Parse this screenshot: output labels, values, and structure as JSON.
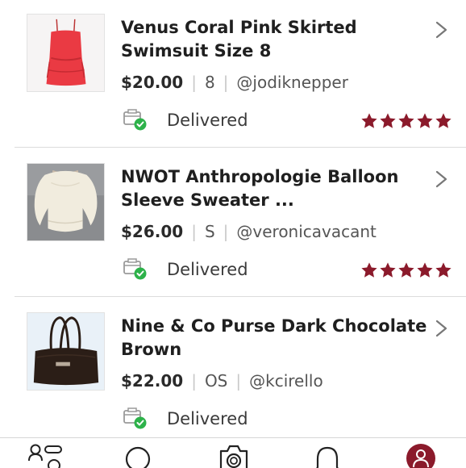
{
  "orders": [
    {
      "title": "Venus Coral Pink Skirted Swimsuit Size 8",
      "price": "$20.00",
      "size": "8",
      "seller": "@jodiknepper",
      "status": "Delivered",
      "rating": 5
    },
    {
      "title": "NWOT Anthropologie Balloon Sleeve Sweater ...",
      "price": "$26.00",
      "size": "S",
      "seller": "@veronicavacant",
      "status": "Delivered",
      "rating": 5
    },
    {
      "title": "Nine & Co Purse Dark Chocolate Brown",
      "price": "$22.00",
      "size": "OS",
      "seller": "@kcirello",
      "status": "Delivered",
      "rating": null
    }
  ],
  "icons": {
    "row_chevron": "chevron-right-icon",
    "status": "package-delivered-icon",
    "rating": "star-icon",
    "nav": [
      "people-feed-icon",
      "search-icon",
      "camera-icon",
      "bell-icon",
      "profile-icon"
    ]
  },
  "colors": {
    "star": "#8b1a2b",
    "delivered_check": "#2db24a",
    "profile_active": "#8b1a2b"
  }
}
